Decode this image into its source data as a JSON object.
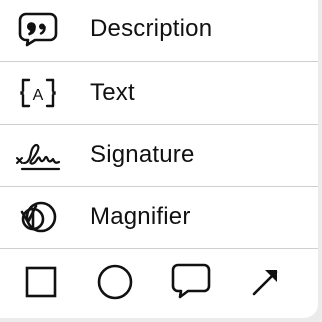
{
  "menu": {
    "items": [
      {
        "label": "Description",
        "icon": "speech-bubble-quote-icon"
      },
      {
        "label": "Text",
        "icon": "text-box-icon"
      },
      {
        "label": "Signature",
        "icon": "signature-icon"
      },
      {
        "label": "Magnifier",
        "icon": "magnifier-icon"
      }
    ]
  },
  "shapes": [
    {
      "icon": "square-icon"
    },
    {
      "icon": "circle-icon"
    },
    {
      "icon": "speech-bubble-icon"
    },
    {
      "icon": "arrow-icon"
    }
  ],
  "colors": {
    "background": "#ffffff",
    "text": "#111111",
    "divider": "#cfcfd3",
    "outer": "#ebebeb"
  }
}
